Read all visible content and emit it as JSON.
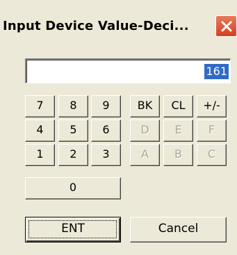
{
  "window": {
    "title": "Input Device Value-Deci...",
    "close_icon": "close-icon"
  },
  "display": {
    "value": "161"
  },
  "keypad": {
    "digits": {
      "k7": "7",
      "k8": "8",
      "k9": "9",
      "k4": "4",
      "k5": "5",
      "k6": "6",
      "k1": "1",
      "k2": "2",
      "k3": "3",
      "k0": "0"
    },
    "functions": {
      "backspace": "BK",
      "clear": "CL",
      "sign": "+/-"
    },
    "hex": {
      "d": "D",
      "e": "E",
      "f": "F",
      "a": "A",
      "b": "B",
      "c": "C"
    }
  },
  "actions": {
    "enter": "ENT",
    "cancel": "Cancel"
  }
}
